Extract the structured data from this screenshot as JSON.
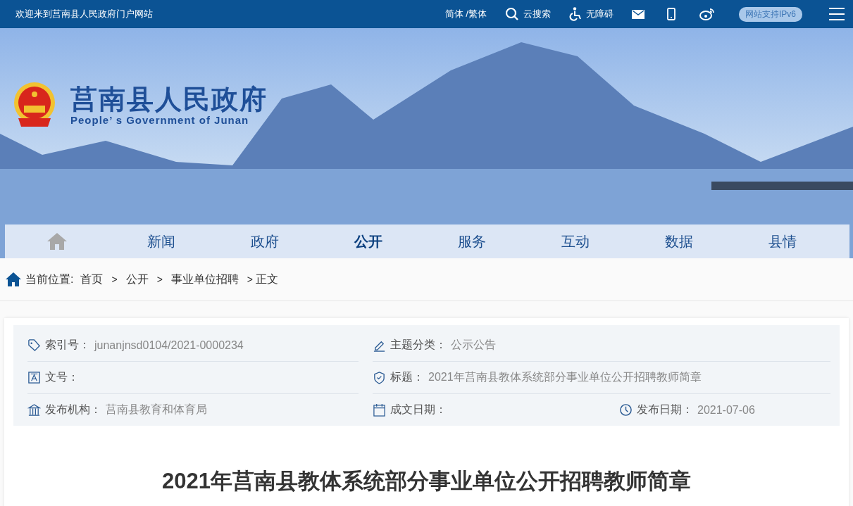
{
  "top_bar": {
    "welcome": "欢迎来到莒南县人民政府门户网站",
    "language": "简体 /繁体",
    "search": "云搜索",
    "accessibility": "无障碍",
    "ipv6_badge": "网站支持IPv6"
  },
  "header": {
    "title": "莒南县人民政府",
    "subtitle": "People’ s Government of Junan"
  },
  "nav": [
    {
      "label": "新闻",
      "selected": false
    },
    {
      "label": "政府",
      "selected": false
    },
    {
      "label": "公开",
      "selected": true
    },
    {
      "label": "服务",
      "selected": false
    },
    {
      "label": "互动",
      "selected": false
    },
    {
      "label": "数据",
      "selected": false
    },
    {
      "label": "县情",
      "selected": false
    }
  ],
  "breadcrumb": {
    "prefix": "当前位置:",
    "separator": ">",
    "items": [
      "首页",
      "公开",
      "事业单位招聘",
      "正文"
    ]
  },
  "info": {
    "rows": [
      {
        "left": {
          "label": "索引号：",
          "value": "junanjnsd0104/2021-0000234"
        },
        "right": [
          {
            "label": "主题分类：",
            "value": "公示公告"
          }
        ]
      },
      {
        "left": {
          "label": "文号："
        },
        "right": [
          {
            "label": "标题：",
            "value": "2021年莒南县教体系统部分事业单位公开招聘教师简章"
          }
        ]
      },
      {
        "left": {
          "label": "发布机构：",
          "value": "莒南县教育和体育局"
        },
        "right": [
          {
            "label": "成文日期："
          },
          {
            "label": "发布日期：",
            "value": "2021-07-06"
          }
        ]
      }
    ]
  },
  "article": {
    "title": "2021年莒南县教体系统部分事业单位公开招聘教师简章"
  }
}
